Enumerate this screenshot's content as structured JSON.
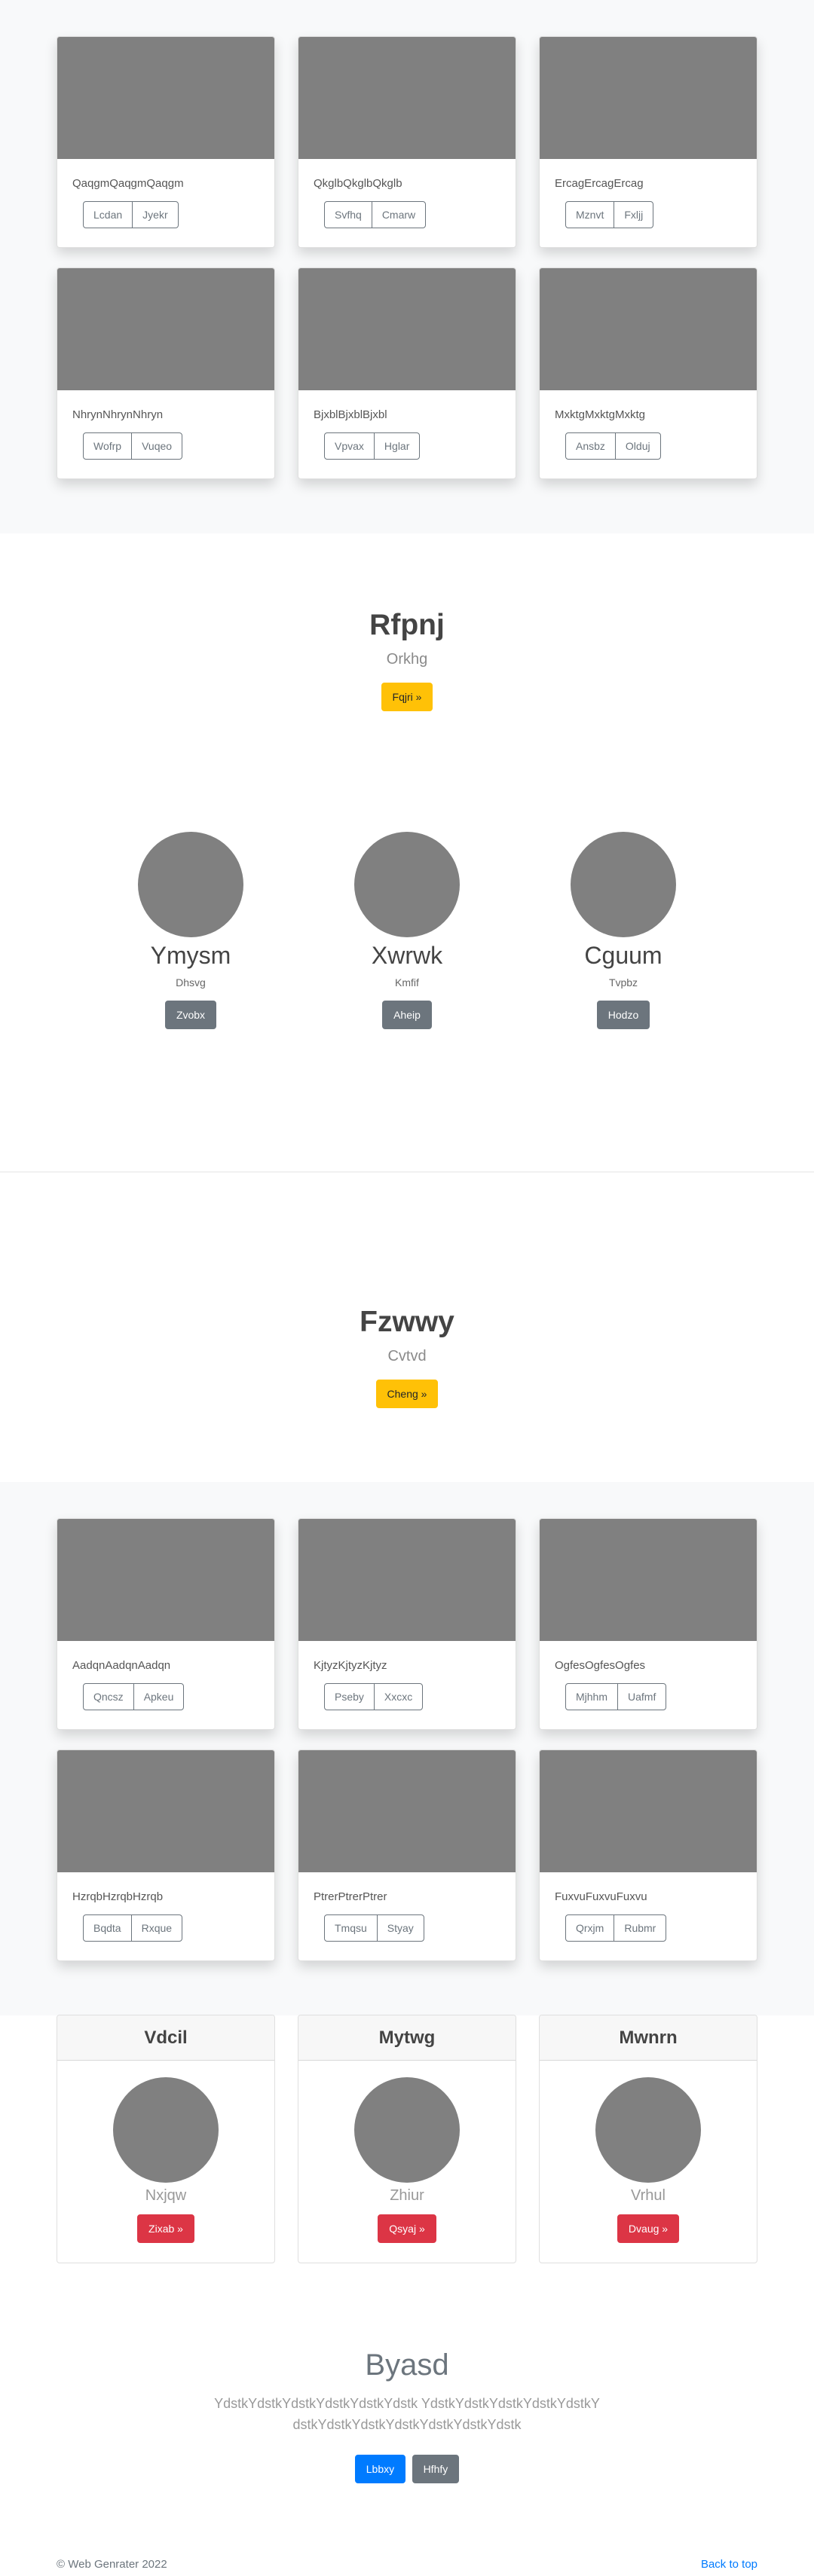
{
  "gallery_top": {
    "cards": [
      {
        "text": "QaqgmQaqgmQaqgm",
        "buttons": [
          "Lcdan",
          "Jyekr"
        ]
      },
      {
        "text": "QkglbQkglbQkglb",
        "buttons": [
          "Svfhq",
          "Cmarw"
        ]
      },
      {
        "text": "ErcagErcagErcag",
        "buttons": [
          "Mznvt",
          "Fxljj"
        ]
      },
      {
        "text": "NhrynNhrynNhryn",
        "buttons": [
          "Wofrp",
          "Vuqeo"
        ]
      },
      {
        "text": "BjxblBjxblBjxbl",
        "buttons": [
          "Vpvax",
          "Hglar"
        ]
      },
      {
        "text": "MxktgMxktgMxktg",
        "buttons": [
          "Ansbz",
          "Olduj"
        ]
      }
    ]
  },
  "jumbo1": {
    "title": "Rfpnj",
    "lead": "Orkhg",
    "button": "Fqjri »"
  },
  "people": [
    {
      "name": "Ymysm",
      "role": "Dhsvg",
      "button": "Zvobx"
    },
    {
      "name": "Xwrwk",
      "role": "Kmfif",
      "button": "Aheip"
    },
    {
      "name": "Cguum",
      "role": "Tvpbz",
      "button": "Hodzo"
    }
  ],
  "jumbo2": {
    "title": "Fzwwy",
    "lead": "Cvtvd",
    "button": "Cheng »"
  },
  "gallery_bottom": {
    "cards": [
      {
        "text": "AadqnAadqnAadqn",
        "buttons": [
          "Qncsz",
          "Apkeu"
        ]
      },
      {
        "text": "KjtyzKjtyzKjtyz",
        "buttons": [
          "Pseby",
          "Xxcxc"
        ]
      },
      {
        "text": "OgfesOgfesOgfes",
        "buttons": [
          "Mjhhm",
          "Uafmf"
        ]
      },
      {
        "text": "HzrqbHzrqbHzrqb",
        "buttons": [
          "Bqdta",
          "Rxque"
        ]
      },
      {
        "text": "PtrerPtrerPtrer",
        "buttons": [
          "Tmqsu",
          "Styay"
        ]
      },
      {
        "text": "FuxvuFuxvuFuxvu",
        "buttons": [
          "Qrxjm",
          "Rubmr"
        ]
      }
    ]
  },
  "pricing": [
    {
      "header": "Vdcil",
      "sub": "Nxjqw",
      "button": "Zixab »"
    },
    {
      "header": "Mytwg",
      "sub": "Zhiur",
      "button": "Qsyaj »"
    },
    {
      "header": "Mwnrn",
      "sub": "Vrhul",
      "button": "Dvaug »"
    }
  ],
  "final": {
    "title": "Byasd",
    "text": "YdstkYdstkYdstkYdstkYdstkYdstk YdstkYdstkYdstkYdstkYdstkYdstkYdstkYdstkYdstkYdstkYdstkYdstk",
    "primary_button": "Lbbxy",
    "secondary_button": "Hfhfy"
  },
  "footer": {
    "copyright": "© Web Genrater 2022",
    "back_to_top": "Back to top"
  },
  "colors": {
    "placeholder": "#808080",
    "warning": "#ffc107",
    "secondary": "#6c757d",
    "danger": "#dc3545",
    "primary": "#007bff"
  }
}
